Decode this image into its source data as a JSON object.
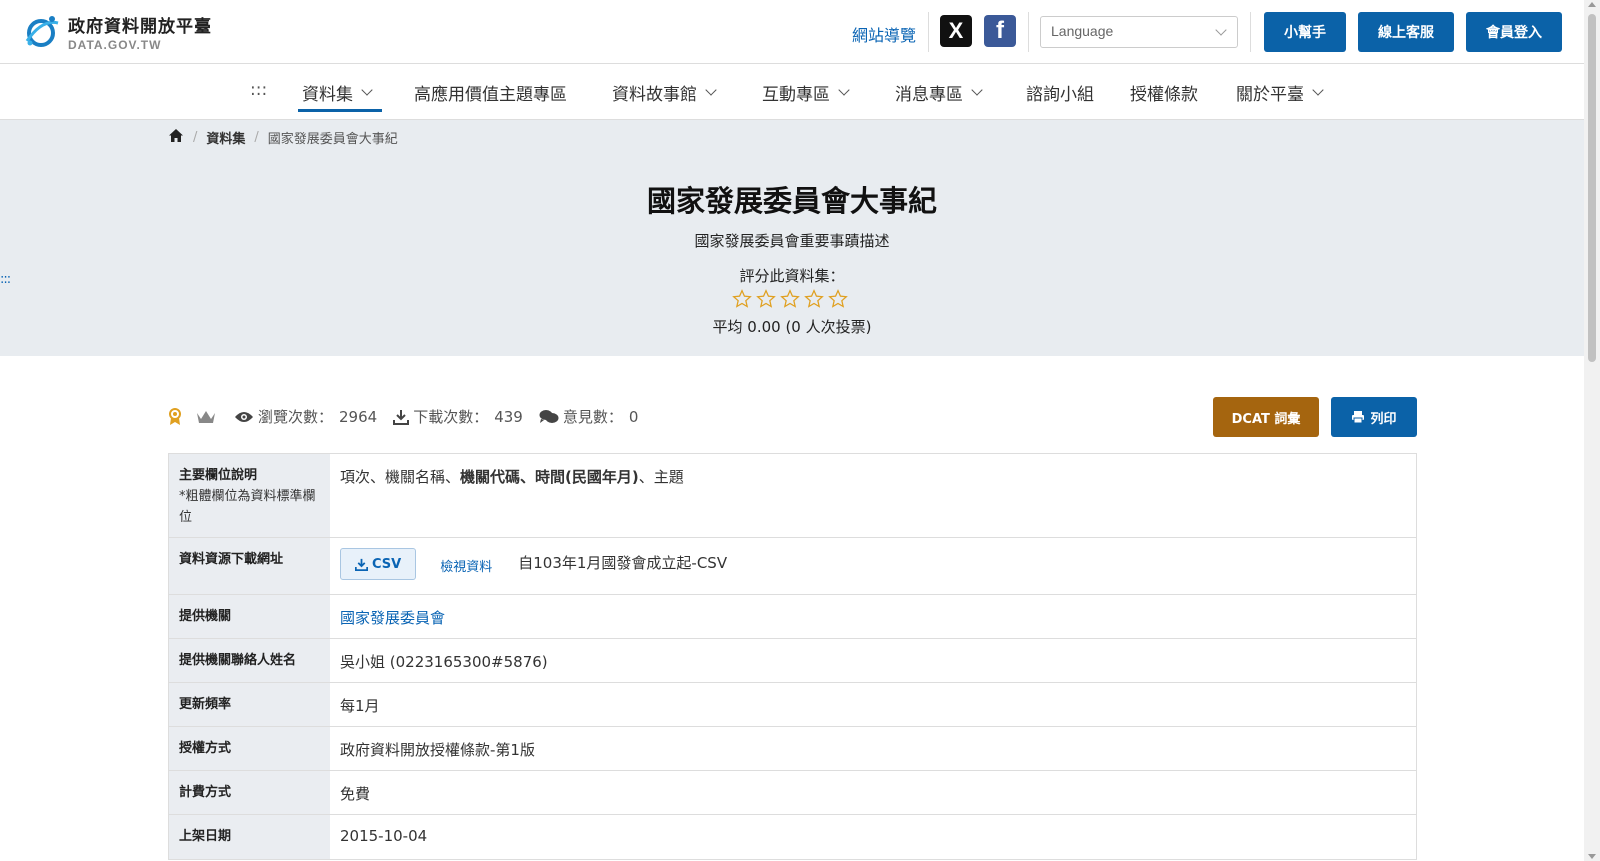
{
  "header": {
    "logo_title": "政府資料開放平臺",
    "logo_sub": "DATA.GOV.TW",
    "sitemap": "網站導覽",
    "social_x": "X",
    "social_fb": "f",
    "language_placeholder": "Language",
    "helper": "小幫手",
    "support": "線上客服",
    "login": "會員登入"
  },
  "nav": {
    "accesskey": ":::",
    "items": [
      "資料集",
      "高應用價值主題專區",
      "資料故事館",
      "互動專區",
      "消息專區",
      "諮詢小組",
      "授權條款",
      "關於平臺"
    ]
  },
  "breadcrumb": {
    "level1": "資料集",
    "current": "國家發展委員會大事紀"
  },
  "hero": {
    "accesskey": ":::",
    "title": "國家發展委員會大事紀",
    "description": "國家發展委員會重要事蹟描述",
    "rate_prompt": "評分此資料集：",
    "rating_value": 0,
    "rating_max": 5,
    "average": "平均 0.00 (0 人次投票)"
  },
  "stats": {
    "views_label": "瀏覽次數：",
    "views": "2964",
    "downloads_label": "下載次數：",
    "downloads": "439",
    "comments_label": "意見數：",
    "comments": "0"
  },
  "actions": {
    "dcat": "DCAT 詞彙",
    "print": "列印"
  },
  "info": {
    "fields_label": "主要欄位說明",
    "fields_note": "*粗體欄位為資料標準欄位",
    "fields_normal_1": "項次、機關名稱、",
    "fields_bold": "機關代碼、時間(民國年月)",
    "fields_normal_2": "、主題",
    "resource_label": "資料資源下載網址",
    "csv_button": "CSV",
    "view_data": "檢視資料",
    "resource_desc": "自103年1月國發會成立起-CSV",
    "provider_label": "提供機關",
    "provider": "國家發展委員會",
    "contact_label": "提供機關聯絡人姓名",
    "contact": "吳小姐 (0223165300#5876)",
    "frequency_label": "更新頻率",
    "frequency": "每1月",
    "license_label": "授權方式",
    "license": "政府資料開放授權條款-第1版",
    "fee_label": "計費方式",
    "fee": "免費",
    "published_label": "上架日期",
    "published": "2015-10-04"
  },
  "colors": {
    "primary": "#0b62a8",
    "dcat": "#a5650f",
    "hero_bg": "#e8ecf0",
    "star": "#e0a020"
  }
}
